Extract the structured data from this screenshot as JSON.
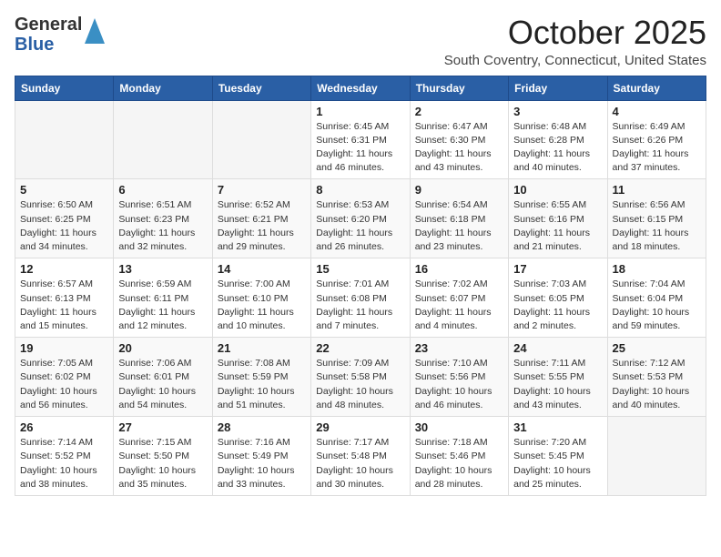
{
  "header": {
    "logo_general": "General",
    "logo_blue": "Blue",
    "month_title": "October 2025",
    "location": "South Coventry, Connecticut, United States"
  },
  "calendar": {
    "days_of_week": [
      "Sunday",
      "Monday",
      "Tuesday",
      "Wednesday",
      "Thursday",
      "Friday",
      "Saturday"
    ],
    "weeks": [
      [
        {
          "day": "",
          "info": ""
        },
        {
          "day": "",
          "info": ""
        },
        {
          "day": "",
          "info": ""
        },
        {
          "day": "1",
          "info": "Sunrise: 6:45 AM\nSunset: 6:31 PM\nDaylight: 11 hours and 46 minutes."
        },
        {
          "day": "2",
          "info": "Sunrise: 6:47 AM\nSunset: 6:30 PM\nDaylight: 11 hours and 43 minutes."
        },
        {
          "day": "3",
          "info": "Sunrise: 6:48 AM\nSunset: 6:28 PM\nDaylight: 11 hours and 40 minutes."
        },
        {
          "day": "4",
          "info": "Sunrise: 6:49 AM\nSunset: 6:26 PM\nDaylight: 11 hours and 37 minutes."
        }
      ],
      [
        {
          "day": "5",
          "info": "Sunrise: 6:50 AM\nSunset: 6:25 PM\nDaylight: 11 hours and 34 minutes."
        },
        {
          "day": "6",
          "info": "Sunrise: 6:51 AM\nSunset: 6:23 PM\nDaylight: 11 hours and 32 minutes."
        },
        {
          "day": "7",
          "info": "Sunrise: 6:52 AM\nSunset: 6:21 PM\nDaylight: 11 hours and 29 minutes."
        },
        {
          "day": "8",
          "info": "Sunrise: 6:53 AM\nSunset: 6:20 PM\nDaylight: 11 hours and 26 minutes."
        },
        {
          "day": "9",
          "info": "Sunrise: 6:54 AM\nSunset: 6:18 PM\nDaylight: 11 hours and 23 minutes."
        },
        {
          "day": "10",
          "info": "Sunrise: 6:55 AM\nSunset: 6:16 PM\nDaylight: 11 hours and 21 minutes."
        },
        {
          "day": "11",
          "info": "Sunrise: 6:56 AM\nSunset: 6:15 PM\nDaylight: 11 hours and 18 minutes."
        }
      ],
      [
        {
          "day": "12",
          "info": "Sunrise: 6:57 AM\nSunset: 6:13 PM\nDaylight: 11 hours and 15 minutes."
        },
        {
          "day": "13",
          "info": "Sunrise: 6:59 AM\nSunset: 6:11 PM\nDaylight: 11 hours and 12 minutes."
        },
        {
          "day": "14",
          "info": "Sunrise: 7:00 AM\nSunset: 6:10 PM\nDaylight: 11 hours and 10 minutes."
        },
        {
          "day": "15",
          "info": "Sunrise: 7:01 AM\nSunset: 6:08 PM\nDaylight: 11 hours and 7 minutes."
        },
        {
          "day": "16",
          "info": "Sunrise: 7:02 AM\nSunset: 6:07 PM\nDaylight: 11 hours and 4 minutes."
        },
        {
          "day": "17",
          "info": "Sunrise: 7:03 AM\nSunset: 6:05 PM\nDaylight: 11 hours and 2 minutes."
        },
        {
          "day": "18",
          "info": "Sunrise: 7:04 AM\nSunset: 6:04 PM\nDaylight: 10 hours and 59 minutes."
        }
      ],
      [
        {
          "day": "19",
          "info": "Sunrise: 7:05 AM\nSunset: 6:02 PM\nDaylight: 10 hours and 56 minutes."
        },
        {
          "day": "20",
          "info": "Sunrise: 7:06 AM\nSunset: 6:01 PM\nDaylight: 10 hours and 54 minutes."
        },
        {
          "day": "21",
          "info": "Sunrise: 7:08 AM\nSunset: 5:59 PM\nDaylight: 10 hours and 51 minutes."
        },
        {
          "day": "22",
          "info": "Sunrise: 7:09 AM\nSunset: 5:58 PM\nDaylight: 10 hours and 48 minutes."
        },
        {
          "day": "23",
          "info": "Sunrise: 7:10 AM\nSunset: 5:56 PM\nDaylight: 10 hours and 46 minutes."
        },
        {
          "day": "24",
          "info": "Sunrise: 7:11 AM\nSunset: 5:55 PM\nDaylight: 10 hours and 43 minutes."
        },
        {
          "day": "25",
          "info": "Sunrise: 7:12 AM\nSunset: 5:53 PM\nDaylight: 10 hours and 40 minutes."
        }
      ],
      [
        {
          "day": "26",
          "info": "Sunrise: 7:14 AM\nSunset: 5:52 PM\nDaylight: 10 hours and 38 minutes."
        },
        {
          "day": "27",
          "info": "Sunrise: 7:15 AM\nSunset: 5:50 PM\nDaylight: 10 hours and 35 minutes."
        },
        {
          "day": "28",
          "info": "Sunrise: 7:16 AM\nSunset: 5:49 PM\nDaylight: 10 hours and 33 minutes."
        },
        {
          "day": "29",
          "info": "Sunrise: 7:17 AM\nSunset: 5:48 PM\nDaylight: 10 hours and 30 minutes."
        },
        {
          "day": "30",
          "info": "Sunrise: 7:18 AM\nSunset: 5:46 PM\nDaylight: 10 hours and 28 minutes."
        },
        {
          "day": "31",
          "info": "Sunrise: 7:20 AM\nSunset: 5:45 PM\nDaylight: 10 hours and 25 minutes."
        },
        {
          "day": "",
          "info": ""
        }
      ]
    ]
  }
}
